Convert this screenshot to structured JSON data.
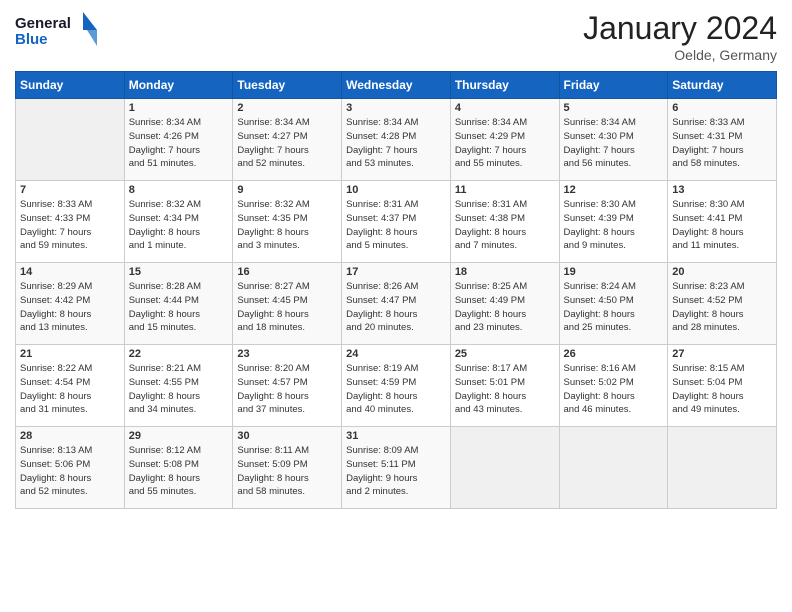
{
  "logo": {
    "line1": "General",
    "line2": "Blue"
  },
  "title": "January 2024",
  "location": "Oelde, Germany",
  "days_of_week": [
    "Sunday",
    "Monday",
    "Tuesday",
    "Wednesday",
    "Thursday",
    "Friday",
    "Saturday"
  ],
  "weeks": [
    [
      {
        "day": "",
        "content": ""
      },
      {
        "day": "1",
        "content": "Sunrise: 8:34 AM\nSunset: 4:26 PM\nDaylight: 7 hours\nand 51 minutes."
      },
      {
        "day": "2",
        "content": "Sunrise: 8:34 AM\nSunset: 4:27 PM\nDaylight: 7 hours\nand 52 minutes."
      },
      {
        "day": "3",
        "content": "Sunrise: 8:34 AM\nSunset: 4:28 PM\nDaylight: 7 hours\nand 53 minutes."
      },
      {
        "day": "4",
        "content": "Sunrise: 8:34 AM\nSunset: 4:29 PM\nDaylight: 7 hours\nand 55 minutes."
      },
      {
        "day": "5",
        "content": "Sunrise: 8:34 AM\nSunset: 4:30 PM\nDaylight: 7 hours\nand 56 minutes."
      },
      {
        "day": "6",
        "content": "Sunrise: 8:33 AM\nSunset: 4:31 PM\nDaylight: 7 hours\nand 58 minutes."
      }
    ],
    [
      {
        "day": "7",
        "content": "Sunrise: 8:33 AM\nSunset: 4:33 PM\nDaylight: 7 hours\nand 59 minutes."
      },
      {
        "day": "8",
        "content": "Sunrise: 8:32 AM\nSunset: 4:34 PM\nDaylight: 8 hours\nand 1 minute."
      },
      {
        "day": "9",
        "content": "Sunrise: 8:32 AM\nSunset: 4:35 PM\nDaylight: 8 hours\nand 3 minutes."
      },
      {
        "day": "10",
        "content": "Sunrise: 8:31 AM\nSunset: 4:37 PM\nDaylight: 8 hours\nand 5 minutes."
      },
      {
        "day": "11",
        "content": "Sunrise: 8:31 AM\nSunset: 4:38 PM\nDaylight: 8 hours\nand 7 minutes."
      },
      {
        "day": "12",
        "content": "Sunrise: 8:30 AM\nSunset: 4:39 PM\nDaylight: 8 hours\nand 9 minutes."
      },
      {
        "day": "13",
        "content": "Sunrise: 8:30 AM\nSunset: 4:41 PM\nDaylight: 8 hours\nand 11 minutes."
      }
    ],
    [
      {
        "day": "14",
        "content": "Sunrise: 8:29 AM\nSunset: 4:42 PM\nDaylight: 8 hours\nand 13 minutes."
      },
      {
        "day": "15",
        "content": "Sunrise: 8:28 AM\nSunset: 4:44 PM\nDaylight: 8 hours\nand 15 minutes."
      },
      {
        "day": "16",
        "content": "Sunrise: 8:27 AM\nSunset: 4:45 PM\nDaylight: 8 hours\nand 18 minutes."
      },
      {
        "day": "17",
        "content": "Sunrise: 8:26 AM\nSunset: 4:47 PM\nDaylight: 8 hours\nand 20 minutes."
      },
      {
        "day": "18",
        "content": "Sunrise: 8:25 AM\nSunset: 4:49 PM\nDaylight: 8 hours\nand 23 minutes."
      },
      {
        "day": "19",
        "content": "Sunrise: 8:24 AM\nSunset: 4:50 PM\nDaylight: 8 hours\nand 25 minutes."
      },
      {
        "day": "20",
        "content": "Sunrise: 8:23 AM\nSunset: 4:52 PM\nDaylight: 8 hours\nand 28 minutes."
      }
    ],
    [
      {
        "day": "21",
        "content": "Sunrise: 8:22 AM\nSunset: 4:54 PM\nDaylight: 8 hours\nand 31 minutes."
      },
      {
        "day": "22",
        "content": "Sunrise: 8:21 AM\nSunset: 4:55 PM\nDaylight: 8 hours\nand 34 minutes."
      },
      {
        "day": "23",
        "content": "Sunrise: 8:20 AM\nSunset: 4:57 PM\nDaylight: 8 hours\nand 37 minutes."
      },
      {
        "day": "24",
        "content": "Sunrise: 8:19 AM\nSunset: 4:59 PM\nDaylight: 8 hours\nand 40 minutes."
      },
      {
        "day": "25",
        "content": "Sunrise: 8:17 AM\nSunset: 5:01 PM\nDaylight: 8 hours\nand 43 minutes."
      },
      {
        "day": "26",
        "content": "Sunrise: 8:16 AM\nSunset: 5:02 PM\nDaylight: 8 hours\nand 46 minutes."
      },
      {
        "day": "27",
        "content": "Sunrise: 8:15 AM\nSunset: 5:04 PM\nDaylight: 8 hours\nand 49 minutes."
      }
    ],
    [
      {
        "day": "28",
        "content": "Sunrise: 8:13 AM\nSunset: 5:06 PM\nDaylight: 8 hours\nand 52 minutes."
      },
      {
        "day": "29",
        "content": "Sunrise: 8:12 AM\nSunset: 5:08 PM\nDaylight: 8 hours\nand 55 minutes."
      },
      {
        "day": "30",
        "content": "Sunrise: 8:11 AM\nSunset: 5:09 PM\nDaylight: 8 hours\nand 58 minutes."
      },
      {
        "day": "31",
        "content": "Sunrise: 8:09 AM\nSunset: 5:11 PM\nDaylight: 9 hours\nand 2 minutes."
      },
      {
        "day": "",
        "content": ""
      },
      {
        "day": "",
        "content": ""
      },
      {
        "day": "",
        "content": ""
      }
    ]
  ]
}
